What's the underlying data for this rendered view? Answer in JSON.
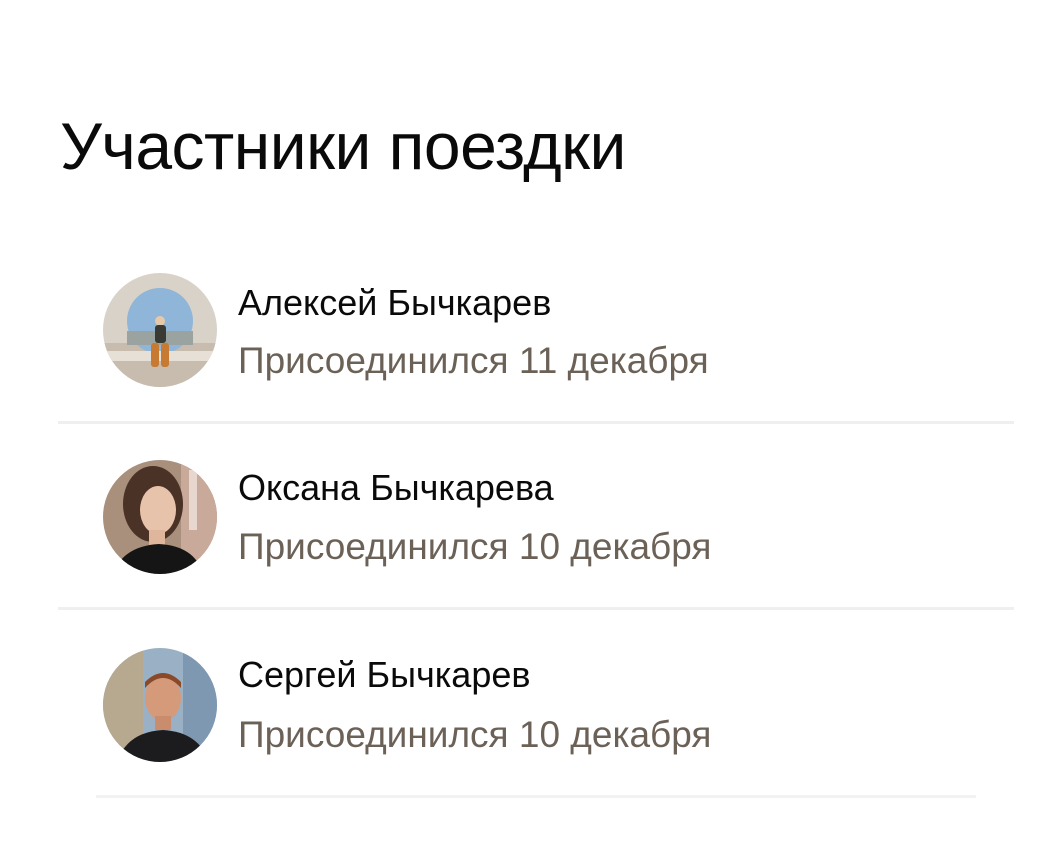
{
  "page": {
    "title": "Участники поездки"
  },
  "members": [
    {
      "name": "Алексей Бычкарев",
      "joined": "Присоединился 11 декабря",
      "avatar": "person-photo-icon"
    },
    {
      "name": "Оксана Бычкарева",
      "joined": "Присоединился 10 декабря",
      "avatar": "person-photo-icon"
    },
    {
      "name": "Сергей Бычкарев",
      "joined": "Присоединился 10 декабря",
      "avatar": "person-photo-icon"
    }
  ],
  "colors": {
    "text_primary": "#0a0a0a",
    "text_secondary": "#6b6157",
    "divider": "#f0efee",
    "background": "#ffffff"
  }
}
